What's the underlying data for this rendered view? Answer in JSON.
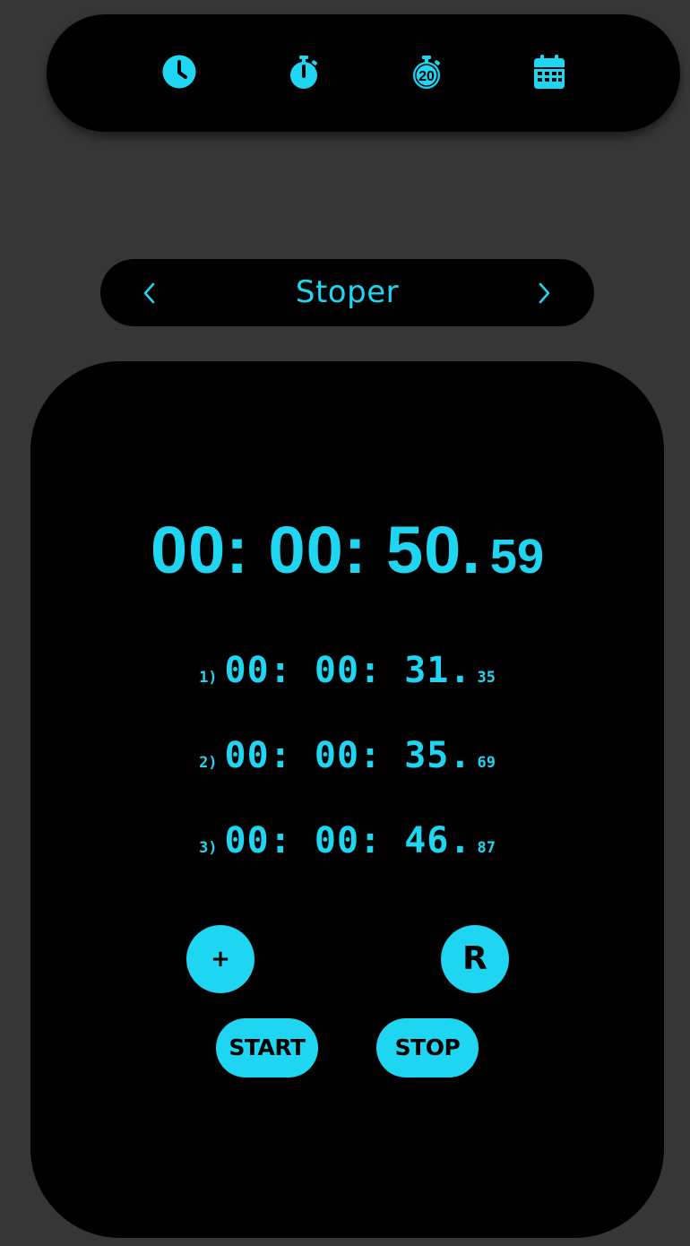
{
  "nav": {
    "icons": [
      "clock-icon",
      "stopwatch-icon",
      "timer-20-icon",
      "calendar-icon"
    ],
    "timer_icon_text": "20"
  },
  "header": {
    "title": "Stoper",
    "prev_icon": "chevron-left-icon",
    "next_icon": "chevron-right-icon"
  },
  "stopwatch": {
    "main": "00: 00: 50.",
    "main_fraction": "59"
  },
  "laps": [
    {
      "index": "1)",
      "time": "00: 00: 31.",
      "fraction": "35"
    },
    {
      "index": "2)",
      "time": "00: 00: 35.",
      "fraction": "69"
    },
    {
      "index": "3)",
      "time": "00: 00: 46.",
      "fraction": "87"
    }
  ],
  "controls": {
    "add_label": "+",
    "reset_label": "R",
    "start_label": "START",
    "stop_label": "STOP"
  },
  "colors": {
    "background": "#363636",
    "panel": "#000000",
    "accent": "#1fd6f2"
  }
}
